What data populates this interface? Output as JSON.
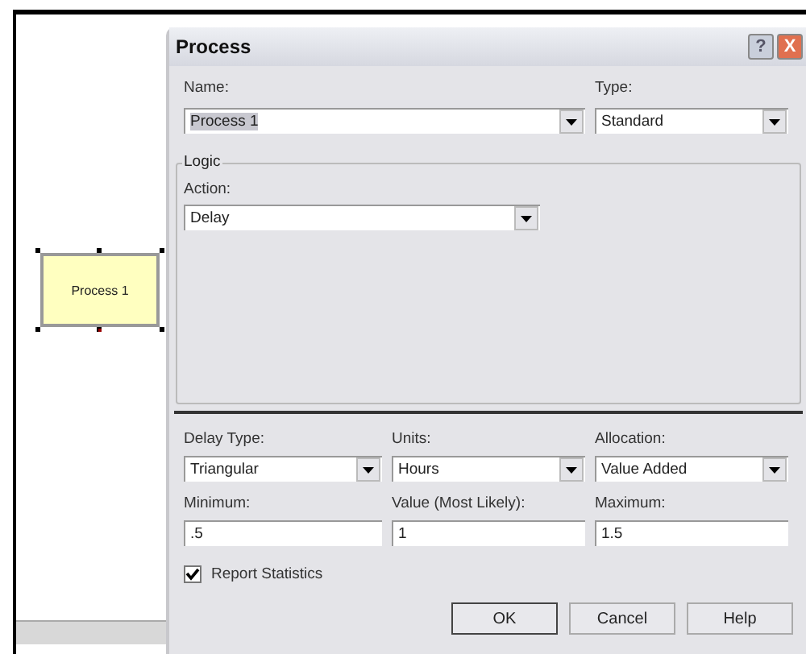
{
  "canvas": {
    "module": {
      "label": "Process 1",
      "selected": true
    }
  },
  "dialog": {
    "title": "Process",
    "help_button": "?",
    "close_button": "X",
    "name": {
      "label": "Name:",
      "value": "Process 1",
      "value_selected": true
    },
    "type": {
      "label": "Type:",
      "value": "Standard"
    },
    "logic": {
      "title": "Logic",
      "action": {
        "label": "Action:",
        "value": "Delay"
      }
    },
    "fields": [
      {
        "kind": "combo",
        "label": "Delay Type:",
        "value": "Triangular"
      },
      {
        "kind": "combo",
        "label": "Units:",
        "value": "Hours"
      },
      {
        "kind": "combo",
        "label": "Allocation:",
        "value": "Value Added"
      },
      {
        "kind": "text",
        "label": "Minimum:",
        "value": ".5"
      },
      {
        "kind": "text",
        "label": "Value (Most Likely):",
        "value": "1"
      },
      {
        "kind": "text",
        "label": "Maximum:",
        "value": "1.5"
      }
    ],
    "report_statistics": {
      "label": "Report Statistics",
      "checked": true
    },
    "buttons": [
      "OK",
      "Cancel",
      "Help"
    ]
  }
}
